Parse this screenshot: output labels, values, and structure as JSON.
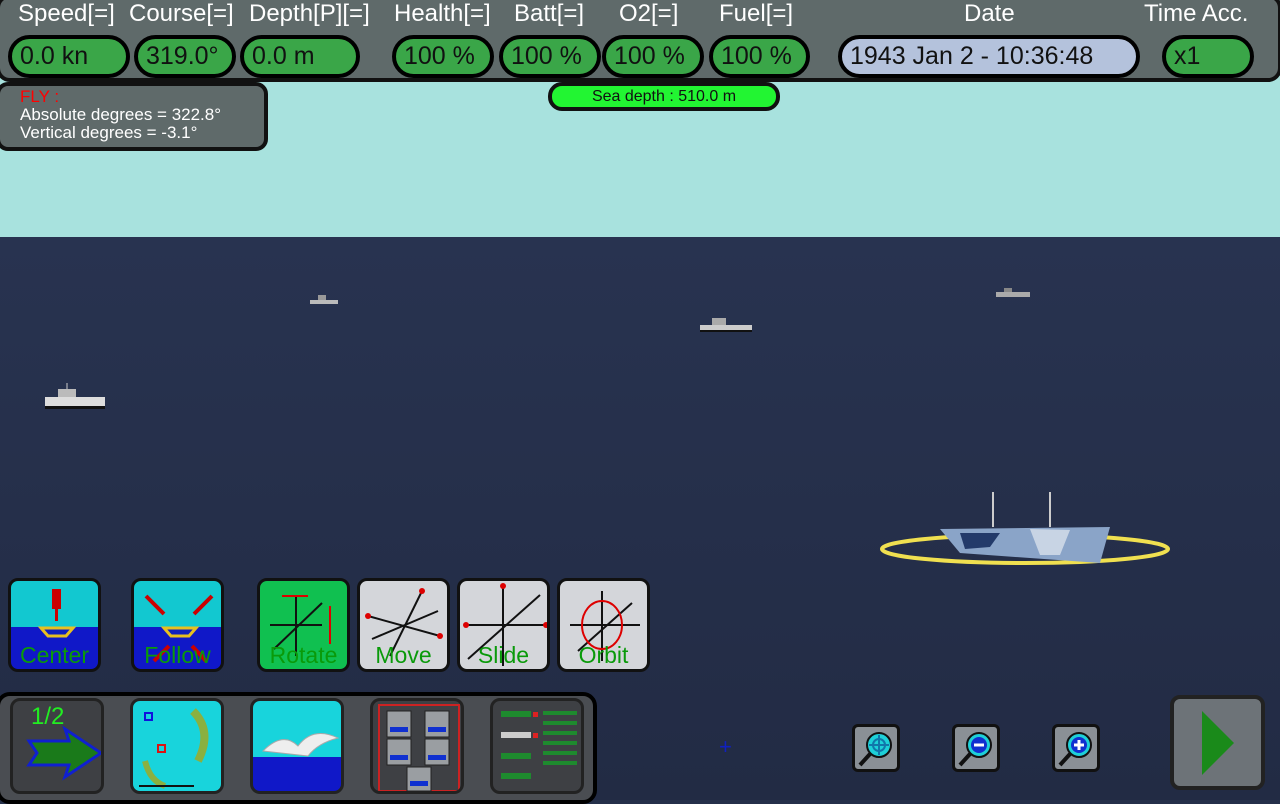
{
  "hud": {
    "speed": {
      "label": "Speed[=]",
      "value": "0.0 kn"
    },
    "course": {
      "label": "Course[=]",
      "value": "319.0°"
    },
    "depth": {
      "label": "Depth[P][=]",
      "value": "0.0 m"
    },
    "health": {
      "label": "Health[=]",
      "value": "100 %"
    },
    "batt": {
      "label": "Batt[=]",
      "value": "100 %"
    },
    "o2": {
      "label": "O2[=]",
      "value": "100 %"
    },
    "fuel": {
      "label": "Fuel[=]",
      "value": "100 %"
    },
    "date": {
      "label": "Date",
      "value": "1943 Jan 2 - 10:36:48"
    },
    "time_acc": {
      "label": "Time Acc.",
      "value": "x1"
    }
  },
  "sea_depth": "Sea depth : 510.0 m",
  "fly": {
    "mode": "FLY :",
    "absolute": "Absolute degrees = 322.8°",
    "vertical": "Vertical degrees = -3.1°"
  },
  "camera_buttons": [
    {
      "label": "Center",
      "icon": "center-ship-icon"
    },
    {
      "label": "Follow",
      "icon": "follow-ship-icon"
    },
    {
      "label": "Rotate",
      "icon": "rotate-axes-icon",
      "active": true
    },
    {
      "label": "Move",
      "icon": "move-axes-icon"
    },
    {
      "label": "Slide",
      "icon": "slide-axes-icon"
    },
    {
      "label": "Orbit",
      "icon": "orbit-axes-icon"
    }
  ],
  "bottom_bar": {
    "page": "1/2",
    "buttons": [
      "next-page-arrow-icon",
      "map-icon",
      "periscope-view-icon",
      "torpedo-tubes-icon",
      "systems-panel-icon"
    ]
  },
  "colors": {
    "sky": "#a8e2de",
    "sea": "#25304a",
    "hud_green": "#3aa648",
    "sea_depth_green": "#22f532",
    "active_green": "#10c050"
  }
}
